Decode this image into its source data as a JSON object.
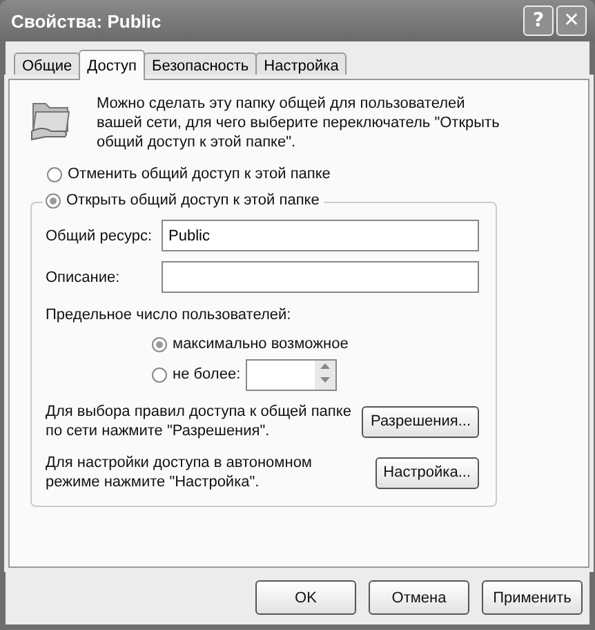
{
  "window": {
    "title": "Свойства: Public",
    "title_buttons": [
      "?",
      "✕"
    ]
  },
  "tabs": [
    {
      "label": "Общие",
      "selected": false
    },
    {
      "label": "Доступ",
      "selected": true
    },
    {
      "label": "Безопасность",
      "selected": false
    },
    {
      "label": "Настройка",
      "selected": false
    }
  ],
  "intro": "Можно сделать эту папку общей для пользователей вашей сети, для чего выберите переключатель \"Открыть общий доступ к этой папке\".",
  "share_options": [
    {
      "label": "Отменить общий доступ к этой папке",
      "selected": false
    },
    {
      "label": "Открыть общий доступ к этой папке",
      "selected": true
    }
  ],
  "fields": [
    {
      "label": "Общий ресурс:",
      "value": "Public"
    },
    {
      "label": "Описание:"
    }
  ],
  "user_limit": {
    "label": "Предельное число пользователей:",
    "options": [
      {
        "label": "максимально возможное",
        "selected": true
      },
      {
        "label": "не более:",
        "selected": false
      }
    ]
  },
  "actions": [
    {
      "text": "Для выбора правил доступа к общей папке по сети нажмите \"Разрешения\".",
      "button": "Разрешения..."
    },
    {
      "text": "Для настройки доступа в автономном режиме нажмите \"Настройка\".",
      "button": "Настройка..."
    }
  ],
  "buttons": [
    "OK",
    "Отмена",
    "Применить"
  ]
}
